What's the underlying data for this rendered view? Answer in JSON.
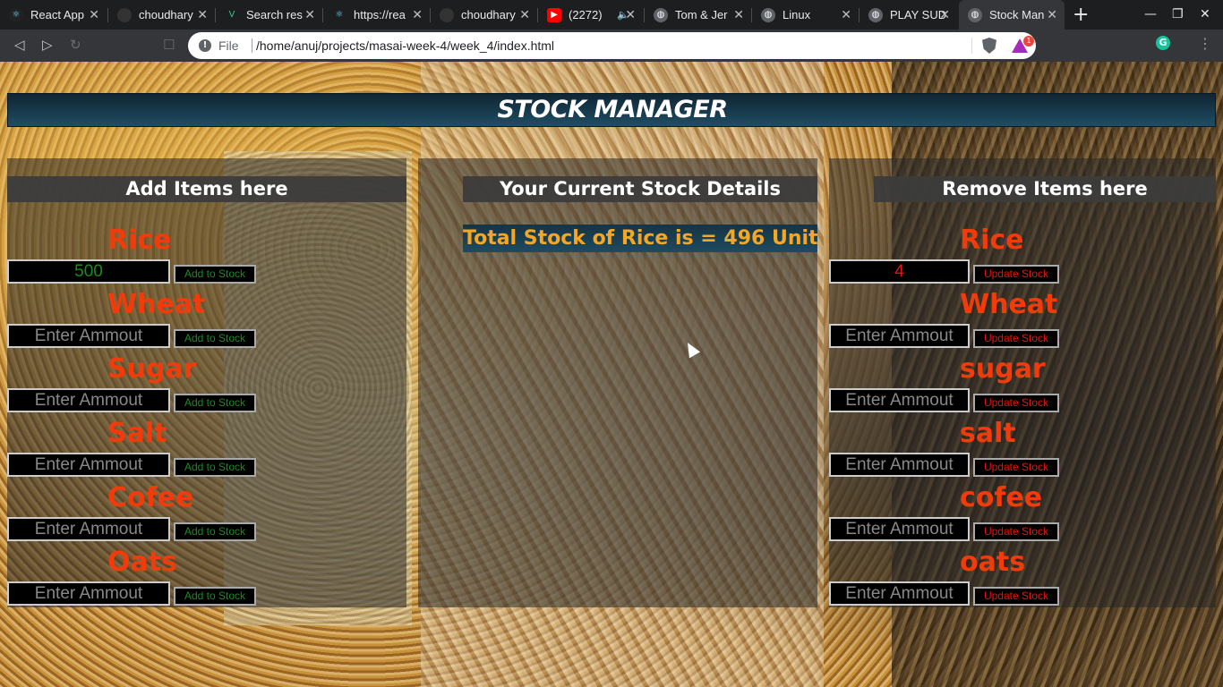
{
  "browser": {
    "tabs": [
      {
        "title": "React App",
        "icon": "react-icon"
      },
      {
        "title": "choudhary",
        "icon": "github-icon"
      },
      {
        "title": "Search res",
        "icon": "vercel-icon"
      },
      {
        "title": "https://rea",
        "icon": "react-icon"
      },
      {
        "title": "choudhary",
        "icon": "github-icon"
      },
      {
        "title": "(2272)",
        "icon": "youtube-icon"
      },
      {
        "title": "Tom & Jer",
        "icon": "globe-icon"
      },
      {
        "title": "Linux",
        "icon": "globe-icon"
      },
      {
        "title": "PLAY SUD",
        "icon": "globe-icon"
      },
      {
        "title": "Stock Man",
        "icon": "globe-icon"
      }
    ],
    "address": {
      "scheme": "File",
      "url": "/home/anuj/projects/masai-week-4/week_4/index.html"
    },
    "rewards_badge": "1",
    "grammarly": "G",
    "accent": "#35363a"
  },
  "page": {
    "title": "STOCK MANAGER",
    "add_panel": {
      "heading": "Add Items here",
      "placeholder": "Enter Ammout",
      "button_label": "Add to Stock",
      "items": [
        {
          "label": "Rice",
          "value": "500"
        },
        {
          "label": "Wheat",
          "value": ""
        },
        {
          "label": "Sugar",
          "value": ""
        },
        {
          "label": "Salt",
          "value": ""
        },
        {
          "label": "Cofee",
          "value": ""
        },
        {
          "label": "Oats",
          "value": ""
        }
      ]
    },
    "stock_panel": {
      "heading": "Your Current Stock Details",
      "stock_line": "Total Stock of Rice is = 496 Unit"
    },
    "remove_panel": {
      "heading": "Remove Items here",
      "placeholder": "Enter Ammout",
      "button_label": "Update Stock",
      "items": [
        {
          "label": "Rice",
          "value": "4"
        },
        {
          "label": "Wheat",
          "value": ""
        },
        {
          "label": "sugar",
          "value": ""
        },
        {
          "label": "salt",
          "value": ""
        },
        {
          "label": "cofee",
          "value": ""
        },
        {
          "label": "oats",
          "value": ""
        }
      ]
    },
    "colors": {
      "label": "#f03c0a",
      "add": "#1d8a1d",
      "update": "#e81010",
      "stock_text": "#f5a623"
    }
  }
}
